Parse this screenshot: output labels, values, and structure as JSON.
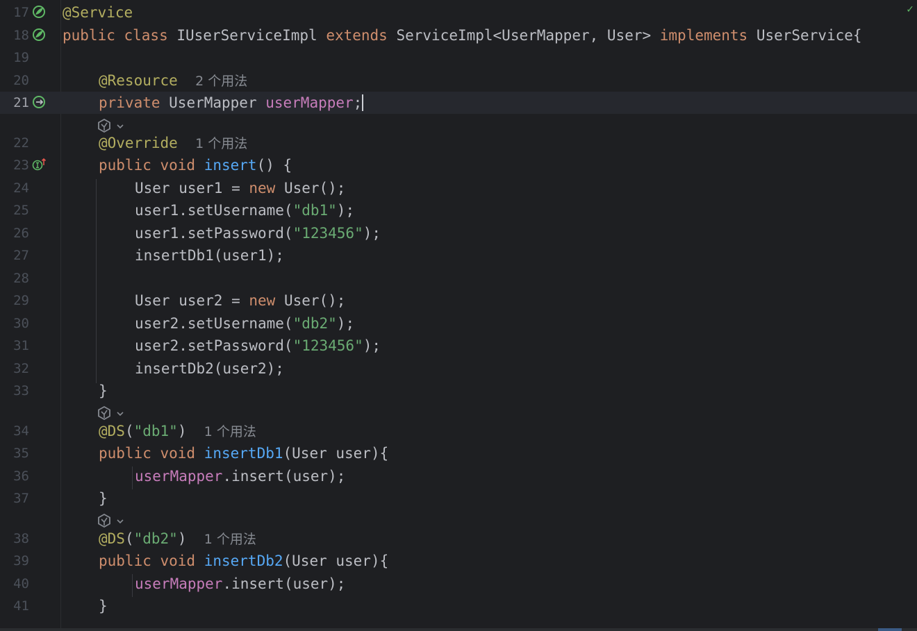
{
  "editor": {
    "language": "java",
    "current_line": "21",
    "status_check": "✓",
    "lines": [
      {
        "n": "17",
        "tokens": [
          {
            "t": "@Service",
            "c": "ann"
          }
        ]
      },
      {
        "n": "18",
        "tokens": [
          {
            "t": "public class ",
            "c": "kw"
          },
          {
            "t": "IUserServiceImpl "
          },
          {
            "t": "extends ",
            "c": "kw"
          },
          {
            "t": "ServiceImpl<UserMapper, User> "
          },
          {
            "t": "implements ",
            "c": "kw"
          },
          {
            "t": "UserService{"
          }
        ]
      },
      {
        "n": "19",
        "tokens": []
      },
      {
        "n": "20",
        "tokens": [
          {
            "t": "@Resource",
            "c": "ann"
          },
          {
            "t": "  "
          },
          {
            "t": "2 个用法",
            "c": "hint"
          }
        ]
      },
      {
        "n": "21",
        "tokens": [
          {
            "t": "private ",
            "c": "kw"
          },
          {
            "t": "UserMapper "
          },
          {
            "t": "userMapper",
            "c": "fld"
          },
          {
            "t": ";"
          }
        ]
      },
      {
        "n": "22",
        "tokens": [
          {
            "t": "@Override",
            "c": "ann"
          },
          {
            "t": "  "
          },
          {
            "t": "1 个用法",
            "c": "hint"
          }
        ]
      },
      {
        "n": "23",
        "tokens": [
          {
            "t": "public void ",
            "c": "kw"
          },
          {
            "t": "insert",
            "c": "fn"
          },
          {
            "t": "() {"
          }
        ]
      },
      {
        "n": "24",
        "tokens": [
          {
            "t": "User user1 = "
          },
          {
            "t": "new ",
            "c": "kw"
          },
          {
            "t": "User();"
          }
        ]
      },
      {
        "n": "25",
        "tokens": [
          {
            "t": "user1.setUsername("
          },
          {
            "t": "\"db1\"",
            "c": "str"
          },
          {
            "t": ");"
          }
        ]
      },
      {
        "n": "26",
        "tokens": [
          {
            "t": "user1.setPassword("
          },
          {
            "t": "\"123456\"",
            "c": "str"
          },
          {
            "t": ");"
          }
        ]
      },
      {
        "n": "27",
        "tokens": [
          {
            "t": "insertDb1(user1);"
          }
        ]
      },
      {
        "n": "28",
        "tokens": []
      },
      {
        "n": "29",
        "tokens": [
          {
            "t": "User user2 = "
          },
          {
            "t": "new ",
            "c": "kw"
          },
          {
            "t": "User();"
          }
        ]
      },
      {
        "n": "30",
        "tokens": [
          {
            "t": "user2.setUsername("
          },
          {
            "t": "\"db2\"",
            "c": "str"
          },
          {
            "t": ");"
          }
        ]
      },
      {
        "n": "31",
        "tokens": [
          {
            "t": "user2.setPassword("
          },
          {
            "t": "\"123456\"",
            "c": "str"
          },
          {
            "t": ");"
          }
        ]
      },
      {
        "n": "32",
        "tokens": [
          {
            "t": "insertDb2(user2);"
          }
        ]
      },
      {
        "n": "33",
        "tokens": [
          {
            "t": "}"
          }
        ]
      },
      {
        "n": "34",
        "tokens": [
          {
            "t": "@DS",
            "c": "ann"
          },
          {
            "t": "("
          },
          {
            "t": "\"db1\"",
            "c": "str"
          },
          {
            "t": ")  "
          },
          {
            "t": "1 个用法",
            "c": "hint"
          }
        ]
      },
      {
        "n": "35",
        "tokens": [
          {
            "t": "public void ",
            "c": "kw"
          },
          {
            "t": "insertDb1",
            "c": "fn"
          },
          {
            "t": "(User user){"
          }
        ]
      },
      {
        "n": "36",
        "tokens": [
          {
            "t": "userMapper",
            "c": "fld"
          },
          {
            "t": ".insert(user);"
          }
        ]
      },
      {
        "n": "37",
        "tokens": [
          {
            "t": "}"
          }
        ]
      },
      {
        "n": "38",
        "tokens": [
          {
            "t": "@DS",
            "c": "ann"
          },
          {
            "t": "("
          },
          {
            "t": "\"db2\"",
            "c": "str"
          },
          {
            "t": ")  "
          },
          {
            "t": "1 个用法",
            "c": "hint"
          }
        ]
      },
      {
        "n": "39",
        "tokens": [
          {
            "t": "public void ",
            "c": "kw"
          },
          {
            "t": "insertDb2",
            "c": "fn"
          },
          {
            "t": "(User user){"
          }
        ]
      },
      {
        "n": "40",
        "tokens": [
          {
            "t": "userMapper",
            "c": "fld"
          },
          {
            "t": ".insert(user);"
          }
        ]
      },
      {
        "n": "41",
        "tokens": [
          {
            "t": "}"
          }
        ]
      }
    ],
    "gutter_icons": {
      "17": "spring-bean-icon",
      "18": "spring-bean-icon",
      "21": "navigate-to-bean-icon",
      "23": "implements-method-icon"
    },
    "inlay_icons": [
      "ai-assistant-icon",
      "ai-assistant-icon",
      "ai-assistant-icon"
    ]
  },
  "colors": {
    "background": "#1e1f22",
    "keyword": "#cf8e6d",
    "annotation": "#b3ae60",
    "string": "#6aab73",
    "field": "#c77dbb",
    "method": "#56a8f5",
    "text": "#bcbec4",
    "hint": "#868a91",
    "line_number": "#4b5059"
  }
}
